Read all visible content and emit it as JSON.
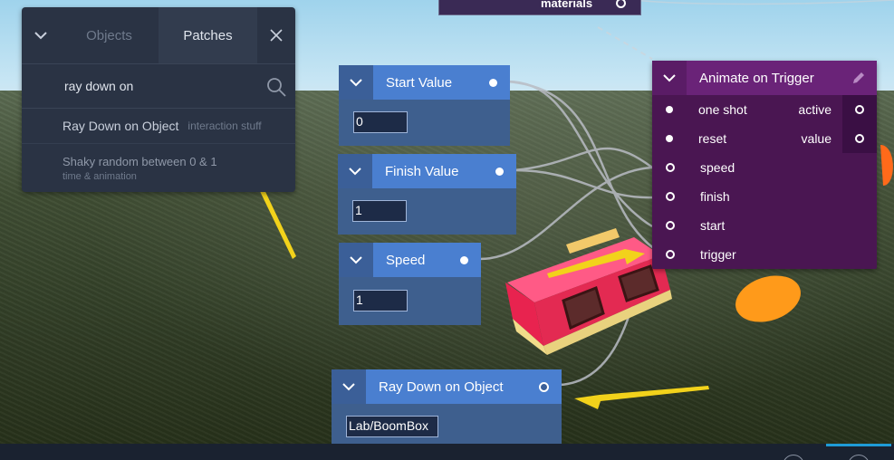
{
  "search_panel": {
    "tabs": [
      "Objects",
      "Patches"
    ],
    "query": "ray down on",
    "results": [
      {
        "name": "Ray Down on Object",
        "category": "interaction stuff"
      },
      {
        "name": "Shaky random between 0 & 1",
        "category": "time & animation"
      }
    ]
  },
  "top_node": {
    "label": "materials"
  },
  "nodes": {
    "start_value": {
      "title": "Start Value",
      "value": "0"
    },
    "finish_value": {
      "title": "Finish Value",
      "value": "1"
    },
    "speed": {
      "title": "Speed",
      "value": "1"
    },
    "ray_down": {
      "title": "Ray Down on Object",
      "value": "Lab/BoomBox"
    }
  },
  "animate_on_trigger": {
    "title": "Animate on Trigger",
    "inputs": [
      "one shot",
      "reset",
      "speed",
      "finish",
      "start",
      "trigger"
    ],
    "outputs": [
      "active",
      "value"
    ]
  },
  "colors": {
    "patch_blue": "#4a7fd0",
    "patch_purple": "#6a2378",
    "annotation_arrow": "#f2d21b",
    "accent": "#1f9bd6"
  }
}
